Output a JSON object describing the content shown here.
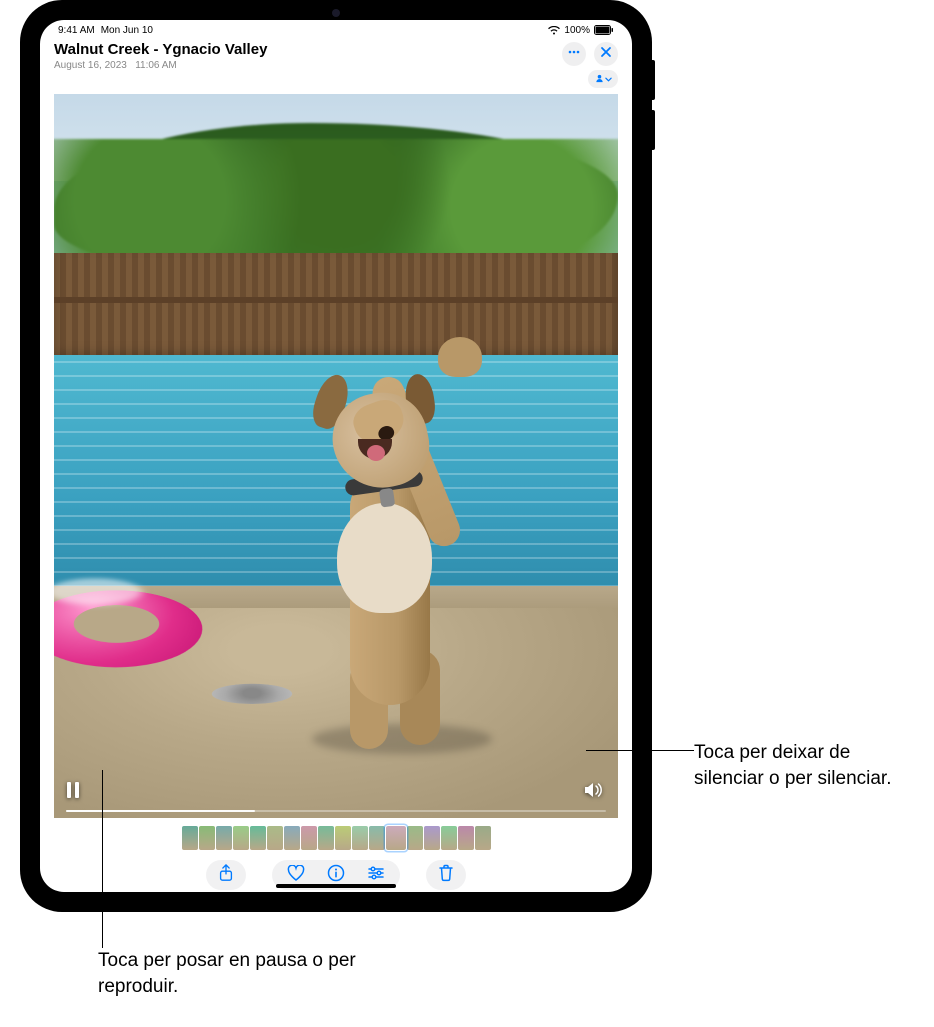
{
  "status": {
    "time": "9:41 AM",
    "date": "Mon Jun 10",
    "battery_pct": "100%"
  },
  "header": {
    "title": "Walnut Creek - Ygnacio Valley",
    "subtitle_date": "August 16, 2023",
    "subtitle_time": "11:06 AM"
  },
  "nav_icons": {
    "more": "more",
    "close": "close",
    "people": "people"
  },
  "video": {
    "play_pause": "pause",
    "mute": "volume",
    "progress_pct": 35
  },
  "toolbar": {
    "share": "share",
    "favorite": "favorite",
    "info": "info",
    "adjust": "adjust",
    "trash": "trash"
  },
  "thumbnails": {
    "count": 18,
    "selected_index": 12
  },
  "callouts": {
    "mute": "Toca per deixar de silenciar o per silenciar.",
    "playpause": "Toca per posar en pausa o per reproduir."
  },
  "colors": {
    "accent": "#007aff"
  }
}
